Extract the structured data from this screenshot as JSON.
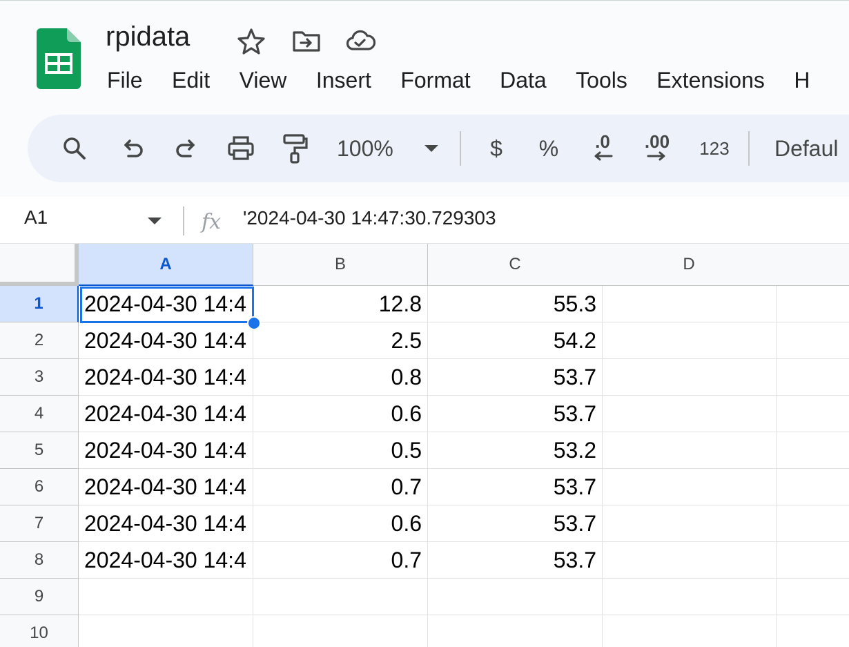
{
  "document": {
    "title": "rpidata"
  },
  "header_icons": [
    "star-icon",
    "move-to-folder-icon",
    "cloud-saved-icon"
  ],
  "menu": {
    "items": [
      "File",
      "Edit",
      "View",
      "Insert",
      "Format",
      "Data",
      "Tools",
      "Extensions",
      "H"
    ]
  },
  "toolbar": {
    "zoom": "100%",
    "currency": "$",
    "percent": "%",
    "decrease_decimal": ".0",
    "increase_decimal": ".00",
    "number_format": "123",
    "font": "Defaul",
    "icons": [
      "search-icon",
      "undo-icon",
      "redo-icon",
      "print-icon",
      "paint-format-icon",
      "zoom-dropdown-icon"
    ]
  },
  "formula_bar": {
    "cell_ref": "A1",
    "fx": "fx",
    "formula": "'2024-04-30 14:47:30.729303"
  },
  "grid": {
    "columns": [
      "A",
      "B",
      "C",
      "D"
    ],
    "selected_column": "A",
    "selected_row": 1,
    "row_numbers": [
      "1",
      "2",
      "3",
      "4",
      "5",
      "6",
      "7",
      "8",
      "9",
      "10"
    ],
    "rows": [
      [
        "2024-04-30 14:4",
        "12.8",
        "55.3",
        ""
      ],
      [
        "2024-04-30 14:4",
        "2.5",
        "54.2",
        ""
      ],
      [
        "2024-04-30 14:4",
        "0.8",
        "53.7",
        ""
      ],
      [
        "2024-04-30 14:4",
        "0.6",
        "53.7",
        ""
      ],
      [
        "2024-04-30 14:4",
        "0.5",
        "53.2",
        ""
      ],
      [
        "2024-04-30 14:4",
        "0.7",
        "53.7",
        ""
      ],
      [
        "2024-04-30 14:4",
        "0.6",
        "53.7",
        ""
      ],
      [
        "2024-04-30 14:4",
        "0.7",
        "53.7",
        ""
      ],
      [
        "",
        "",
        "",
        ""
      ],
      [
        "",
        "",
        "",
        ""
      ]
    ]
  },
  "colors": {
    "accent": "#1a73e8",
    "sheets_green": "#0f9d58",
    "toolbar_bg": "#edf2fa",
    "header_bg": "#f9fbfd",
    "selection_header": "#d3e3fd"
  }
}
